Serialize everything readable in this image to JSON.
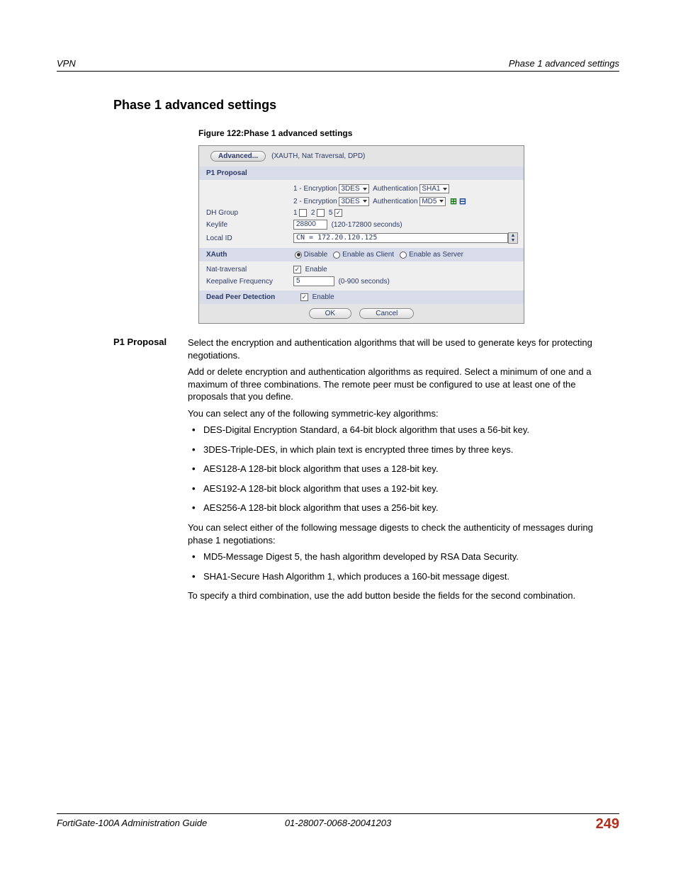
{
  "header": {
    "left": "VPN",
    "right": "Phase 1 advanced settings"
  },
  "title": "Phase 1 advanced settings",
  "figure_caption": "Figure 122:Phase 1 advanced settings",
  "screenshot": {
    "advanced_btn": "Advanced...",
    "advanced_note": "(XAUTH, Nat Traversal, DPD)",
    "p1_proposal": "P1 Proposal",
    "row1_enc_label": "1 - Encryption",
    "row1_enc_val": "3DES",
    "row1_auth_label": "Authentication",
    "row1_auth_val": "SHA1",
    "row2_enc_label": "2 - Encryption",
    "row2_enc_val": "3DES",
    "row2_auth_label": "Authentication",
    "row2_auth_val": "MD5",
    "dh_group": "DH Group",
    "dh_1": "1",
    "dh_2": "2",
    "dh_5": "5",
    "keylife": "Keylife",
    "keylife_val": "28800",
    "keylife_note": "(120-172800 seconds)",
    "local_id": "Local ID",
    "local_id_val": "CN = 172.20.120.125",
    "xauth": "XAuth",
    "xauth_disable": "Disable",
    "xauth_client": "Enable as Client",
    "xauth_server": "Enable as Server",
    "nat_traversal": "Nat-traversal",
    "enable": "Enable",
    "keepalive": "Keepalive Frequency",
    "keepalive_val": "5",
    "keepalive_note": "(0-900 seconds)",
    "dpd": "Dead Peer Detection",
    "ok": "OK",
    "cancel": "Cancel"
  },
  "desc": {
    "label": "P1 Proposal",
    "p1": "Select the encryption and authentication algorithms that will be used to generate keys for protecting negotiations.",
    "p2": "Add or delete encryption and authentication algorithms as required. Select a minimum of one and a maximum of three combinations. The remote peer must be configured to use at least one of the proposals that you define.",
    "p3": "You can select any of the following symmetric-key algorithms:",
    "sym": [
      "DES-Digital Encryption Standard, a 64-bit block algorithm that uses a 56-bit key.",
      "3DES-Triple-DES, in which plain text is encrypted three times by three keys.",
      "AES128-A 128-bit block algorithm that uses a 128-bit key.",
      "AES192-A 128-bit block algorithm that uses a 192-bit key.",
      "AES256-A 128-bit block algorithm that uses a 256-bit key."
    ],
    "p4": "You can select either of the following message digests to check the authenticity of messages during phase 1 negotiations:",
    "dig": [
      "MD5-Message Digest 5, the hash algorithm developed by RSA Data Security.",
      "SHA1-Secure Hash Algorithm 1, which produces a 160-bit message digest."
    ],
    "p5": "To specify a third combination, use the add button beside the fields for the second combination."
  },
  "footer": {
    "left": "FortiGate-100A Administration Guide",
    "center": "01-28007-0068-20041203",
    "right": "249"
  }
}
